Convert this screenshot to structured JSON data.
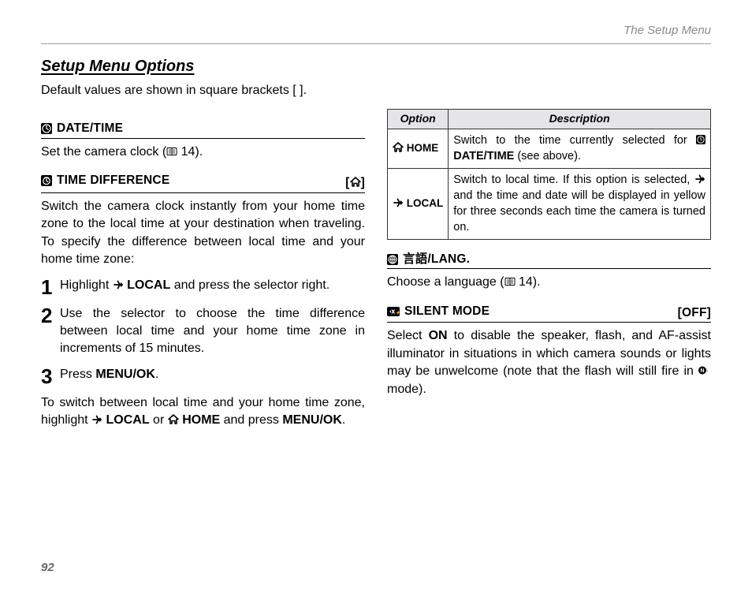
{
  "page": {
    "running_head": "The Setup Menu",
    "number": "92",
    "title": "Setup Menu Options",
    "intro": "Default values are shown in square brackets [ ]."
  },
  "left": {
    "date_time": {
      "heading": "DATE/TIME",
      "body_pre": "Set the camera clock (",
      "body_ref": " 14).",
      "icon": "clock-icon"
    },
    "time_diff": {
      "heading": "TIME DIFFERENCE",
      "default_open": "[",
      "default_close": "]",
      "body": "Switch the camera clock instantly from your home time zone to the local time at your destination when traveling.  To specify the difference between local time and your home time zone:",
      "steps": [
        {
          "pre": "Highlight ",
          "bold": "LOCAL",
          "post": " and press the selector right."
        },
        {
          "text": "Use the selector to choose the time difference between local time and your home time zone in increments of 15 minutes."
        },
        {
          "pre": "Press ",
          "bold": "MENU/OK",
          "post": "."
        }
      ],
      "footer": {
        "pre": "To switch between local time and your home time zone, highlight ",
        "local": "LOCAL",
        "or": " or ",
        "home": "HOME",
        "mid": " and press ",
        "menu": "MENU/OK",
        "post": "."
      }
    }
  },
  "right": {
    "table": {
      "head_option": "Option",
      "head_desc": "Description",
      "rows": [
        {
          "opt": "HOME",
          "desc_pre": "Switch to the time currently selected for ",
          "desc_bold": "DATE/TIME",
          "desc_post": " (see above)."
        },
        {
          "opt": "LOCAL",
          "desc": "Switch to local time.  If this option is selected, ",
          "desc_mid": " and the time and date will be displayed in yellow for three seconds each time the camera is turned on."
        }
      ]
    },
    "lang": {
      "heading": "言語/LANG.",
      "body_pre": "Choose a language (",
      "body_ref": " 14)."
    },
    "silent": {
      "heading": "SILENT MODE",
      "default": "[OFF]",
      "body_pre": "Select ",
      "body_on": "ON",
      "body_mid": " to disable the speaker, flash, and AF-assist illuminator in situations in which camera sounds or lights may be unwelcome (note that the flash will still fire in ",
      "body_post": " mode)."
    }
  }
}
